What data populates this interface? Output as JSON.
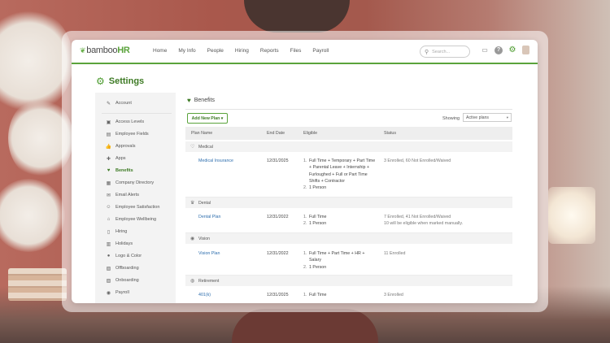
{
  "nav": {
    "logo_bamboo": "bamboo",
    "logo_hr": "HR",
    "items": [
      "Home",
      "My Info",
      "People",
      "Hiring",
      "Reports",
      "Files",
      "Payroll"
    ],
    "search_placeholder": "Search..."
  },
  "page": {
    "title": "Settings"
  },
  "sidebar": {
    "items": [
      {
        "label": "Account",
        "icon": "wrench-icon"
      },
      {
        "label": "Access Levels",
        "icon": "lock-icon"
      },
      {
        "label": "Employee Fields",
        "icon": "card-icon"
      },
      {
        "label": "Approvals",
        "icon": "thumbs-up-icon"
      },
      {
        "label": "Apps",
        "icon": "puzzle-icon"
      },
      {
        "label": "Benefits",
        "icon": "heart-icon"
      },
      {
        "label": "Company Directory",
        "icon": "directory-icon"
      },
      {
        "label": "Email Alerts",
        "icon": "envelope-icon"
      },
      {
        "label": "Employee Satisfaction",
        "icon": "smiley-icon"
      },
      {
        "label": "Employee Wellbeing",
        "icon": "house-heart-icon"
      },
      {
        "label": "Hiring",
        "icon": "clipboard-icon"
      },
      {
        "label": "Holidays",
        "icon": "calendar-icon"
      },
      {
        "label": "Logo & Color",
        "icon": "palette-icon"
      },
      {
        "label": "Offboarding",
        "icon": "exit-icon"
      },
      {
        "label": "Onboarding",
        "icon": "enter-icon"
      },
      {
        "label": "Payroll",
        "icon": "payroll-icon"
      }
    ],
    "active": "Benefits"
  },
  "benefits": {
    "heading": "Benefits",
    "add_button": "Add New Plan",
    "showing_label": "Showing",
    "filter_value": "Active plans",
    "columns": [
      "Plan Name",
      "End Date",
      "Eligible",
      "Status"
    ],
    "sections": [
      {
        "name": "Medical",
        "plans": [
          {
            "name": "Medical Insurance",
            "end_date": "12/31/2025",
            "eligible": [
              "Full Time + Temporary + Part Time + Parental Leave + Internship + Furloughed + Full or Part Time Shifts + Contractor",
              "1 Person"
            ],
            "status": [
              "3 Enrolled, 60 Not Enrolled/Waived"
            ]
          }
        ]
      },
      {
        "name": "Dental",
        "plans": [
          {
            "name": "Dental Plan",
            "end_date": "12/31/2022",
            "eligible": [
              "Full Time",
              "1 Person"
            ],
            "status": [
              "7 Enrolled, 41 Not Enrolled/Waived",
              "10 will be eligible when marked manually."
            ]
          }
        ]
      },
      {
        "name": "Vision",
        "plans": [
          {
            "name": "Vision Plan",
            "end_date": "12/31/2022",
            "eligible": [
              "Full Time + Part Time + HR + Salary",
              "1 Person"
            ],
            "status": [
              "11 Enrolled"
            ]
          }
        ]
      },
      {
        "name": "Retirement",
        "plans": [
          {
            "name": "401(k)",
            "end_date": "12/31/2025",
            "eligible": [
              "Full Time"
            ],
            "status": [
              "3 Enrolled"
            ]
          }
        ]
      }
    ]
  },
  "colors": {
    "brand_green": "#5aa33b",
    "link_blue": "#2f6fae"
  }
}
